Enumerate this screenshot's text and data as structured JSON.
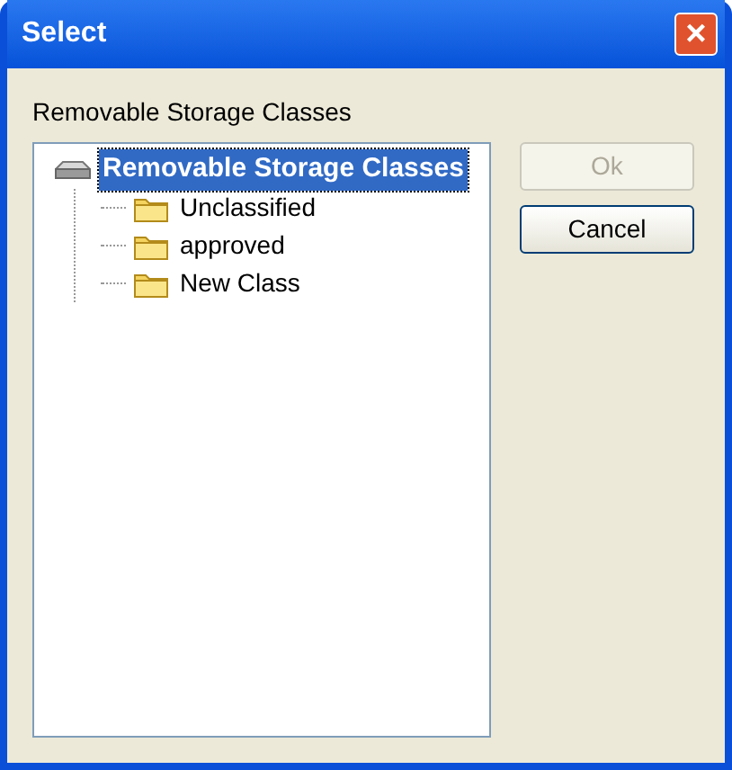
{
  "window": {
    "title": "Select",
    "close": "×"
  },
  "tree_label": "Removable Storage Classes",
  "tree": [
    {
      "label": "Removable Storage Classes",
      "kind": "drive",
      "selected": true,
      "children": [
        {
          "label": "Unclassified",
          "kind": "folder",
          "selected": false
        },
        {
          "label": "approved",
          "kind": "folder",
          "selected": false
        },
        {
          "label": "New Class",
          "kind": "folder",
          "selected": false
        }
      ]
    }
  ],
  "buttons": [
    {
      "label": "Ok",
      "disabled": true
    },
    {
      "label": "Cancel",
      "disabled": false
    }
  ]
}
